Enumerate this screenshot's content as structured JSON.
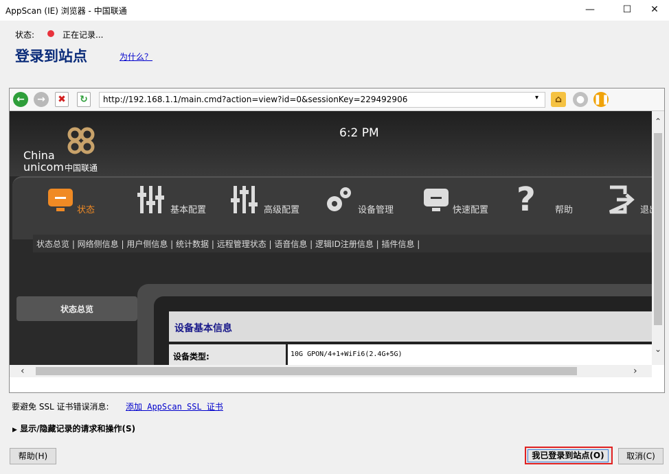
{
  "window": {
    "title": "AppScan (IE) 浏览器 - 中国联通",
    "minimize": "—",
    "maximize": "☐",
    "close": "✕"
  },
  "status": {
    "label": "状态:",
    "recording_text": "正在记录...",
    "recording_color": "#e8323c"
  },
  "heading": {
    "title": "登录到站点",
    "why_link": "为什么？"
  },
  "browser": {
    "url": "http://192.168.1.1/main.cmd?action=view?id=0&sessionKey=229492906",
    "toolbar_icons": [
      "back-icon",
      "forward-icon",
      "stop-icon",
      "refresh-icon",
      "home-icon",
      "record-icon",
      "pause-icon"
    ]
  },
  "router_page": {
    "clock": "6:2 PM",
    "logo_line1": "China",
    "logo_line2": "unicom",
    "logo_cn": "中国联通",
    "nav": [
      {
        "label": "状态",
        "icon": "monitor-icon",
        "active": true
      },
      {
        "label": "基本配置",
        "icon": "sliders-icon",
        "active": false
      },
      {
        "label": "高级配置",
        "icon": "sliders-advanced-icon",
        "active": false
      },
      {
        "label": "设备管理",
        "icon": "gears-icon",
        "active": false
      },
      {
        "label": "快速配置",
        "icon": "monitor-gray-icon",
        "active": false
      },
      {
        "label": "帮助",
        "icon": "question-icon",
        "active": false
      },
      {
        "label": "退出",
        "icon": "exit-icon",
        "active": false
      }
    ],
    "subnav": "状态总览 | 网络侧信息 | 用户侧信息 | 统计数据 | 远程管理状态 | 语音信息 | 逻辑ID注册信息 | 插件信息 |",
    "left_menu": "状态总览",
    "info_heading": "设备基本信息",
    "info_rows": [
      {
        "label": "设备类型:",
        "value": "10G GPON/4+1+WiFi6(2.4G+5G)"
      }
    ]
  },
  "bottom": {
    "ssl_label": "要避免 SSL 证书错误消息:",
    "ssl_link": "添加 AppScan SSL 证书",
    "toggle": "显示/隐藏记录的请求和操作(S)",
    "help_button": "帮助(H)",
    "done_button": "我已登录到站点(O)",
    "cancel_button": "取消(C)"
  }
}
